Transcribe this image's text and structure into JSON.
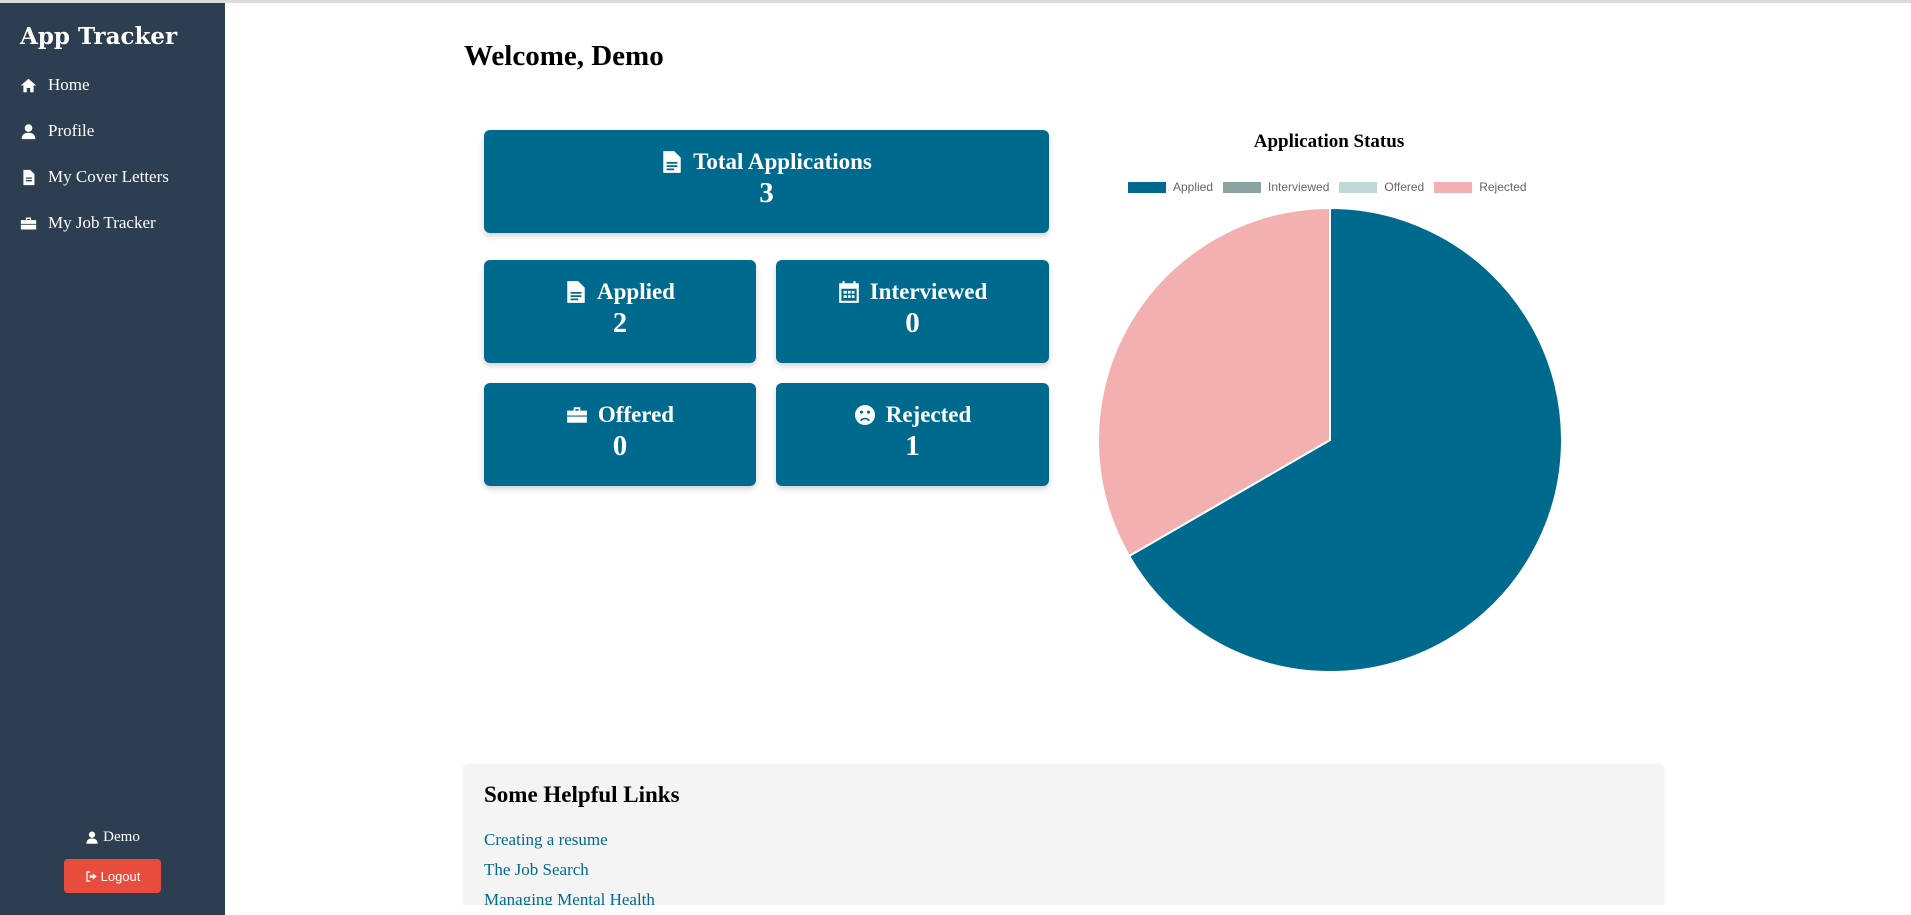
{
  "sidebar": {
    "brand": "App Tracker",
    "items": [
      {
        "label": "Home",
        "icon": "home-icon"
      },
      {
        "label": "Profile",
        "icon": "user-icon"
      },
      {
        "label": "My Cover Letters",
        "icon": "file-icon"
      },
      {
        "label": "My Job Tracker",
        "icon": "briefcase-icon"
      }
    ],
    "user": "Demo",
    "logout_label": "Logout"
  },
  "main": {
    "welcome": "Welcome, Demo",
    "cards": {
      "total": {
        "label": "Total Applications",
        "value": "3",
        "icon": "file-icon"
      },
      "applied": {
        "label": "Applied",
        "value": "2",
        "icon": "file-icon"
      },
      "interviewed": {
        "label": "Interviewed",
        "value": "0",
        "icon": "calendar-icon"
      },
      "offered": {
        "label": "Offered",
        "value": "0",
        "icon": "briefcase-icon"
      },
      "rejected": {
        "label": "Rejected",
        "value": "1",
        "icon": "frown-icon"
      }
    }
  },
  "chart_data": {
    "type": "pie",
    "title": "Application Status",
    "categories": [
      "Applied",
      "Interviewed",
      "Offered",
      "Rejected"
    ],
    "values": [
      2,
      0,
      0,
      1
    ],
    "colors": [
      "#006a8e",
      "#8aa39f",
      "#bfd8d7",
      "#f2b1b0"
    ],
    "legend": "top"
  },
  "links": {
    "heading": "Some Helpful Links",
    "items": [
      "Creating a resume",
      "The Job Search",
      "Managing Mental Health"
    ]
  },
  "colors": {
    "sidebar": "#2c3e50",
    "card": "#006a8e",
    "logout": "#e74c3c"
  }
}
